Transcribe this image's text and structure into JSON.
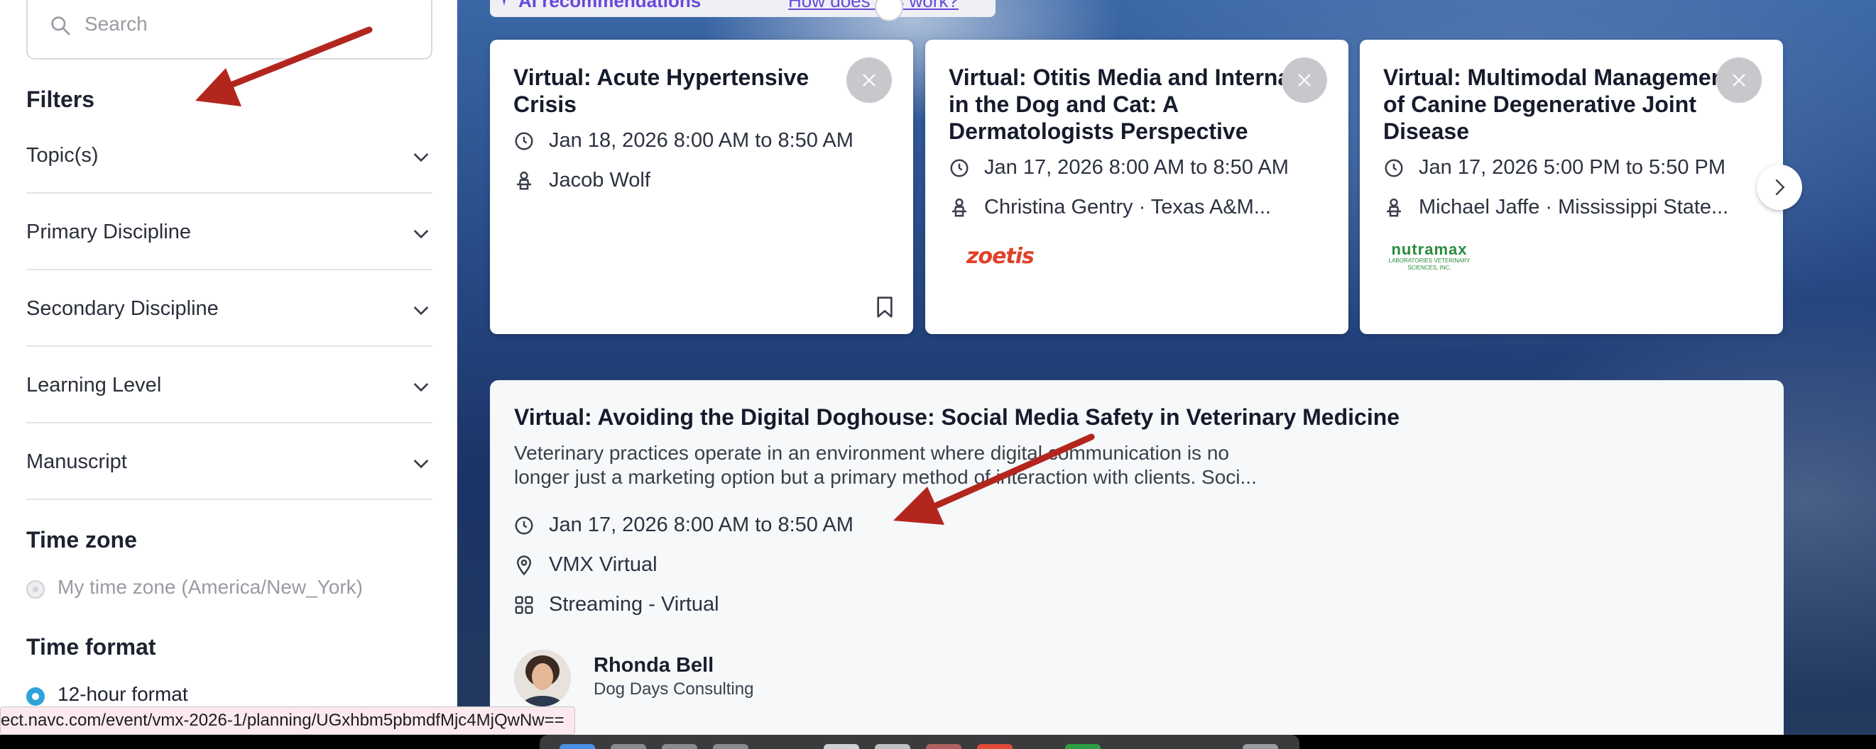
{
  "sidebar": {
    "search_placeholder": "Search",
    "filters_heading": "Filters",
    "filters": [
      "Topic(s)",
      "Primary Discipline",
      "Secondary Discipline",
      "Learning Level",
      "Manuscript"
    ],
    "timezone_heading": "Time zone",
    "timezone_option": "My time zone (America/New_York)",
    "timeformat_heading": "Time format",
    "timeformat_option": "12-hour format"
  },
  "recommendations": {
    "label": "AI recommendations",
    "link": "How does this work?"
  },
  "cards": [
    {
      "title": "Virtual: Acute Hypertensive Crisis",
      "datetime": "Jan 18, 2026 8:00 AM to 8:50 AM",
      "speaker": "Jacob Wolf"
    },
    {
      "title": "Virtual: Otitis Media and Interna in the Dog and Cat: A Dermatologists Perspective",
      "datetime": "Jan 17, 2026 8:00 AM to 8:50 AM",
      "speaker": "Christina Gentry · Texas A&M...",
      "sponsor": "zoetis"
    },
    {
      "title": "Virtual: Multimodal Management of Canine Degenerative Joint Disease",
      "datetime": "Jan 17, 2026 5:00 PM to 5:50 PM",
      "speaker": "Michael Jaffe · Mississippi State...",
      "sponsor": "nutramax",
      "sponsor_sub": "LABORATORIES VETERINARY SCIENCES, INC."
    }
  ],
  "session": {
    "title": "Virtual: Avoiding the Digital Doghouse: Social Media Safety in Veterinary Medicine",
    "description_line1": "Veterinary practices operate in an environment where digital communication is no",
    "description_line2": "longer just a marketing option but a primary method of interaction with clients. Soci...",
    "datetime": "Jan 17, 2026 8:00 AM to 8:50 AM",
    "location": "VMX Virtual",
    "format": "Streaming - Virtual",
    "speaker_name": "Rhonda Bell",
    "speaker_org": "Dog Days Consulting"
  },
  "status_url": "ect.navc.com/event/vmx-2026-1/planning/UGxhbm5pbmdfMjc4MjQwNw==",
  "colors": {
    "accent_purple": "#6a48d8",
    "radio_on": "#2ea3d9",
    "annotation_arrow": "#b3261e",
    "zoetis": "#e0412b",
    "nutramax": "#2b8a3e"
  },
  "icons": [
    "search-icon",
    "chevron-down-icon",
    "clock-icon",
    "speaker-icon",
    "location-icon",
    "grid-icon",
    "close-icon",
    "bookmark-icon",
    "chevron-right-icon",
    "sparkle-icon"
  ]
}
